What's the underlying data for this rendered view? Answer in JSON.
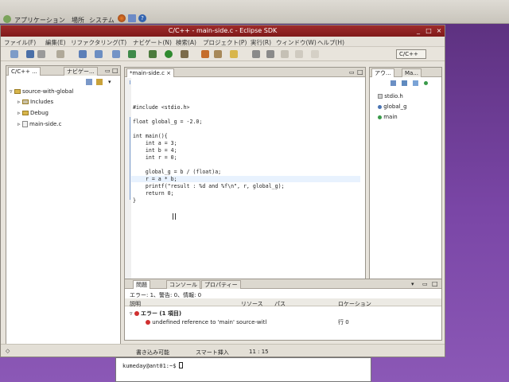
{
  "top_panel": {
    "menus": [
      "アプリケーション",
      "場所",
      "システム"
    ]
  },
  "window": {
    "title": "C/C++ - main-side.c - Eclipse SDK",
    "menu": [
      "ファイル(F)",
      "編集(E)",
      "リファクタリング(T)",
      "ナビゲート(N)",
      "検索(A)",
      "プロジェクト(P)",
      "実行(R)",
      "ウィンドウ(W)",
      "ヘルプ(H)"
    ],
    "perspective": "C/C++"
  },
  "project_explorer": {
    "tabs": [
      "C/C++ ...",
      "ナビゲー..."
    ],
    "project": "source-with-global",
    "children": [
      "Includes",
      "Debug",
      "main-side.c"
    ]
  },
  "editor": {
    "tab": "*main-side.c",
    "lines": [
      "#include <stdio.h>",
      "",
      "float global_g = -2.0;",
      "",
      "int main(){",
      "    int a = 3;",
      "    int b = 4;",
      "    int r = 0;",
      "",
      "    global_g = b / (float)a;",
      "    r = a * b;",
      "    printf(\"result : %d and %f\\n\", r, global_g);",
      "    return 0;",
      "}"
    ]
  },
  "outline": {
    "tabs": [
      "アウ...",
      "Ma..."
    ],
    "items": [
      "stdio.h",
      "global_g",
      "main"
    ]
  },
  "problems": {
    "tabs": [
      "問題",
      "コンソール",
      "プロパティー"
    ],
    "summary": "エラー: 1、警告: 0、情報: 0",
    "columns": [
      "説明",
      "リソース",
      "パス",
      "ロケーション"
    ],
    "group": "エラー (1 項目)",
    "error_text": "undefined reference to 'main'",
    "error_resource": "source-witl",
    "error_location": "行 0"
  },
  "status_bar": {
    "writable": "書き込み可能",
    "insert": "スマート挿入",
    "position": "11 : 15"
  },
  "terminal": {
    "prompt": "kumeday@ant01:~$"
  }
}
